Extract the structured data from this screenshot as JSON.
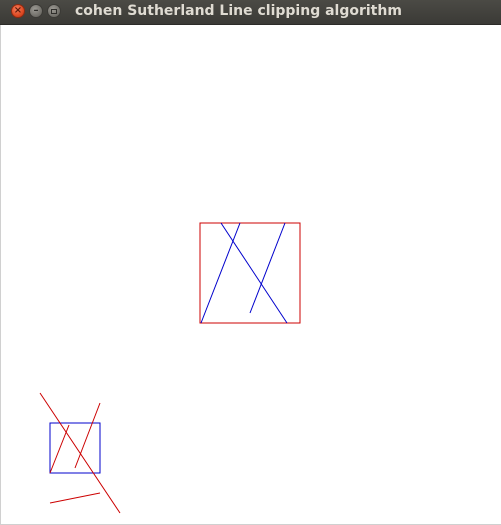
{
  "window": {
    "title": "cohen Sutherland Line clipping algorithm",
    "close_icon": "close-icon",
    "minimize_icon": "minimize-icon",
    "maximize_icon": "maximize-icon"
  },
  "colors": {
    "clip_window_clipped_view": "#cc0000",
    "clipped_lines": "#0000cc",
    "clip_window_original_view": "#0000cc",
    "original_lines": "#cc0000",
    "background": "#ffffff"
  }
}
